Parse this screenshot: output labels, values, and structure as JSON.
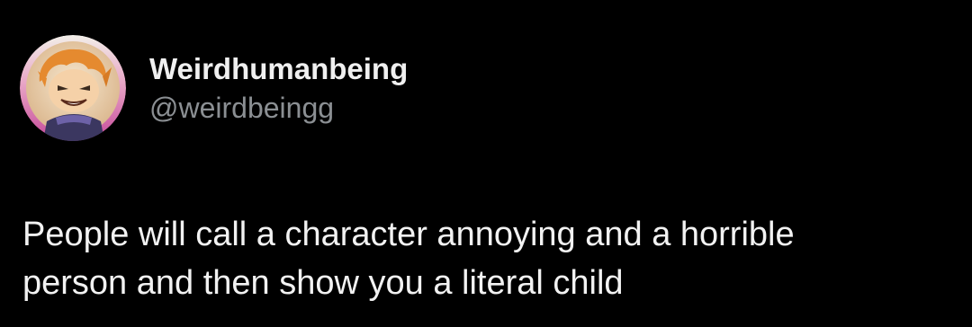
{
  "user": {
    "display_name": "Weirdhumanbeing",
    "handle": "@weirdbeingg",
    "avatar_icon": "cartoon-character-avatar"
  },
  "tweet": {
    "lines": [
      "People will call a character annoying and a horrible",
      "person and then show you a literal child"
    ]
  },
  "colors": {
    "background": "#000000",
    "text": "#f2f2f2",
    "handle": "#8b8f93"
  }
}
